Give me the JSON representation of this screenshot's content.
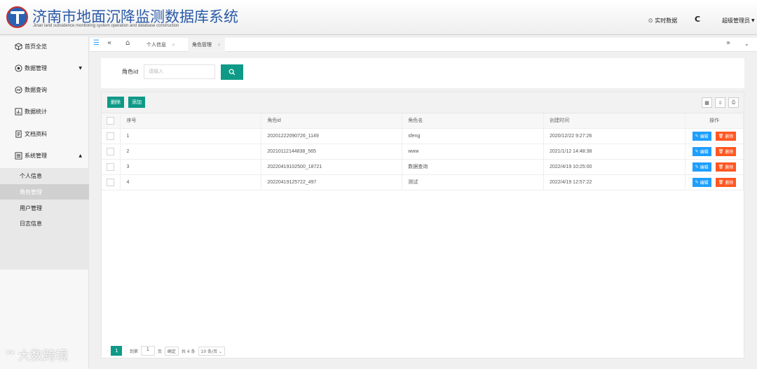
{
  "header": {
    "title": "济南市地面沉降监测数据库系统",
    "subtitle": "Jinan land subsidence monitoring system operation and database construction",
    "realtime_label": "实时数据",
    "admin_label": "超级管理员"
  },
  "sidebar": {
    "items": [
      {
        "label": "首页全览",
        "icon": "cube-icon"
      },
      {
        "label": "数据管理",
        "icon": "data-icon",
        "expanded": false
      },
      {
        "label": "数据查询",
        "icon": "trend-icon"
      },
      {
        "label": "数据统计",
        "icon": "chart-icon"
      },
      {
        "label": "文档资料",
        "icon": "doc-icon"
      },
      {
        "label": "系统管理",
        "icon": "settings-icon",
        "expanded": true
      }
    ],
    "subitems": [
      "个人信息",
      "角色管理",
      "用户管理",
      "日志信息"
    ]
  },
  "tabs": [
    {
      "label": "个人信息",
      "active": false
    },
    {
      "label": "角色管理",
      "active": true
    }
  ],
  "search": {
    "label": "角色id",
    "placeholder": "请输入"
  },
  "toolbar": {
    "delete_label": "删除",
    "add_label": "添加"
  },
  "table": {
    "headers": [
      "序号",
      "角色id",
      "角色名",
      "创建时间",
      "操作"
    ],
    "rows": [
      {
        "no": "1",
        "id": "20201222090726_1149",
        "name": "sfeng",
        "time": "2020/12/22 9:27:26"
      },
      {
        "no": "2",
        "id": "20210112144838_565",
        "name": "www",
        "time": "2021/1/12 14:48:38"
      },
      {
        "no": "3",
        "id": "20220419102500_18721",
        "name": "数据查询",
        "time": "2022/4/19 10:25:00"
      },
      {
        "no": "4",
        "id": "20220419125722_497",
        "name": "测试",
        "time": "2022/4/19 12:57:22"
      }
    ],
    "edit_label": "编辑",
    "delete_label": "删除"
  },
  "pagination": {
    "current_page": "1",
    "goto_label": "到第",
    "page_input": "1",
    "page_unit": "页",
    "confirm_label": "确定",
    "total_label": "共 4 条",
    "page_size_label": "10 条/页"
  },
  "watermark": "大数跨境",
  "colors": {
    "accent": "#0e9a87",
    "edit": "#1e9fff",
    "delete": "#ff5722",
    "title": "#2a5aa8"
  }
}
